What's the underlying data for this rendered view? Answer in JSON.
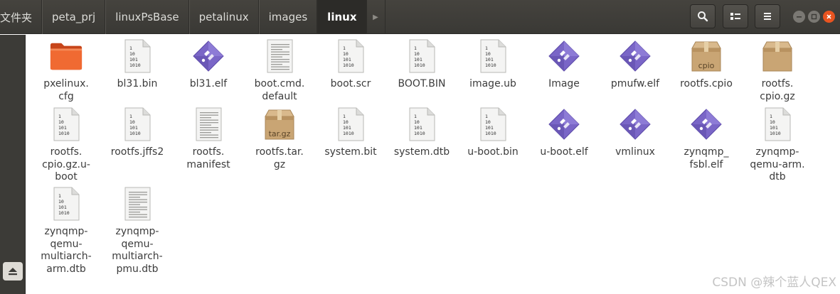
{
  "breadcrumb": [
    "文件夹",
    "peta_prj",
    "linuxPsBase",
    "petalinux",
    "images",
    "linux"
  ],
  "header": {
    "search_icon": "search-icon",
    "view_icon": "list-view-icon",
    "menu_icon": "hamburger-menu-icon"
  },
  "window_controls": [
    "minimize",
    "maximize",
    "close"
  ],
  "sidebar": {
    "eject_icon": "eject-icon"
  },
  "files": [
    {
      "name": "pxelinux.\ncfg",
      "icon": "folder"
    },
    {
      "name": "bl31.bin",
      "icon": "binary"
    },
    {
      "name": "bl31.elf",
      "icon": "executable"
    },
    {
      "name": "boot.cmd.\ndefault",
      "icon": "text"
    },
    {
      "name": "boot.scr",
      "icon": "binary"
    },
    {
      "name": "BOOT.BIN",
      "icon": "binary"
    },
    {
      "name": "image.ub",
      "icon": "binary"
    },
    {
      "name": "Image",
      "icon": "executable"
    },
    {
      "name": "pmufw.elf",
      "icon": "executable"
    },
    {
      "name": "rootfs.cpio",
      "icon": "archive",
      "badge": "cpio"
    },
    {
      "name": "rootfs.\ncpio.gz",
      "icon": "archive"
    },
    {
      "name": "rootfs.\ncpio.gz.u-\nboot",
      "icon": "binary"
    },
    {
      "name": "rootfs.jffs2",
      "icon": "binary"
    },
    {
      "name": "rootfs.\nmanifest",
      "icon": "text"
    },
    {
      "name": "rootfs.tar.\ngz",
      "icon": "archive",
      "badge": "tar.gz"
    },
    {
      "name": "system.bit",
      "icon": "binary"
    },
    {
      "name": "system.dtb",
      "icon": "binary"
    },
    {
      "name": "u-boot.bin",
      "icon": "binary"
    },
    {
      "name": "u-boot.elf",
      "icon": "executable"
    },
    {
      "name": "vmlinux",
      "icon": "executable"
    },
    {
      "name": "zynqmp_\nfsbl.elf",
      "icon": "executable"
    },
    {
      "name": "zynqmp-\nqemu-arm.\ndtb",
      "icon": "binary"
    },
    {
      "name": "zynqmp-\nqemu-\nmultiarch-\narm.dtb",
      "icon": "binary"
    },
    {
      "name": "zynqmp-\nqemu-\nmultiarch-\npmu.dtb",
      "icon": "text"
    }
  ],
  "binary_glyph_lines": [
    "1",
    "10",
    "101",
    "1010"
  ],
  "watermark": "CSDN @辣个蓝人QEX",
  "colors": {
    "header_bg": "#3c3b37",
    "folder_orange": "#e95420",
    "executable_purple": "#7a66c7",
    "archive_brown": "#c8a070"
  }
}
